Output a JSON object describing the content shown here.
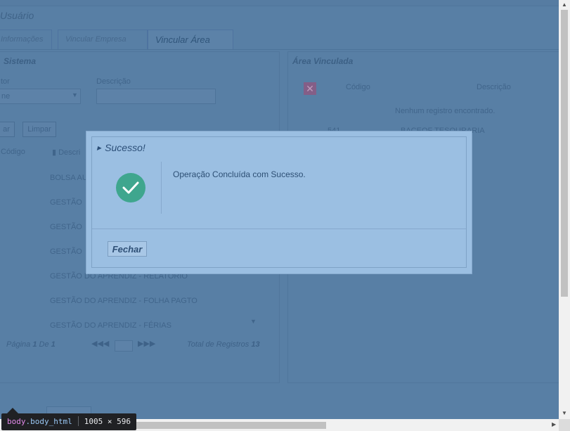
{
  "background": {
    "title": "Usuário",
    "tabs": [
      "Informações",
      "Vincular Empresa",
      "Vincular Área"
    ],
    "left_panel": {
      "heading": "Sistema",
      "filter_label": "tor",
      "filter_value": "ne",
      "description_label": "Descrição",
      "search_button": "ar",
      "clear_button": "Limpar",
      "col_code": "Código",
      "col_desc": "Descri",
      "rows": [
        {
          "code": "",
          "desc": "BOLSA AU"
        },
        {
          "code": "",
          "desc": "GESTÃO"
        },
        {
          "code": "",
          "desc": "GESTÃO"
        },
        {
          "code": "",
          "desc": "GESTÃO"
        },
        {
          "code": "",
          "desc": "GESTÃO DO APRENDIZ - RELATÓRIO"
        },
        {
          "code": "",
          "desc": "GESTÃO DO APRENDIZ - FOLHA PAGTO"
        },
        {
          "code": "",
          "desc": "GESTÃO DO APRENDIZ - FÉRIAS"
        }
      ],
      "pager_page_label": "Página",
      "pager_page": "1",
      "pager_of": "De",
      "pager_total_pages": "1",
      "pager_total_label": "Total de Registros",
      "pager_total": "13"
    },
    "right_panel": {
      "heading": "Área Vinculada",
      "col_code": "Código",
      "col_desc": "Descrição",
      "empty_text": "Nenhum registro encontrado.",
      "row_code": "541",
      "row_desc": "BACEOF TESOURARIA"
    }
  },
  "dialog": {
    "title": "Sucesso!",
    "message": "Operação Concluída com Sucesso.",
    "close_label": "Fechar",
    "icon": "check-circle-icon",
    "icon_color": "#3fa68e"
  },
  "devtools_tooltip": {
    "tag": "body",
    "class": ".body_html",
    "size": "1005 × 596"
  },
  "colors": {
    "overlay": "#5b80a6",
    "dialog_bg": "#9bbfe2"
  }
}
